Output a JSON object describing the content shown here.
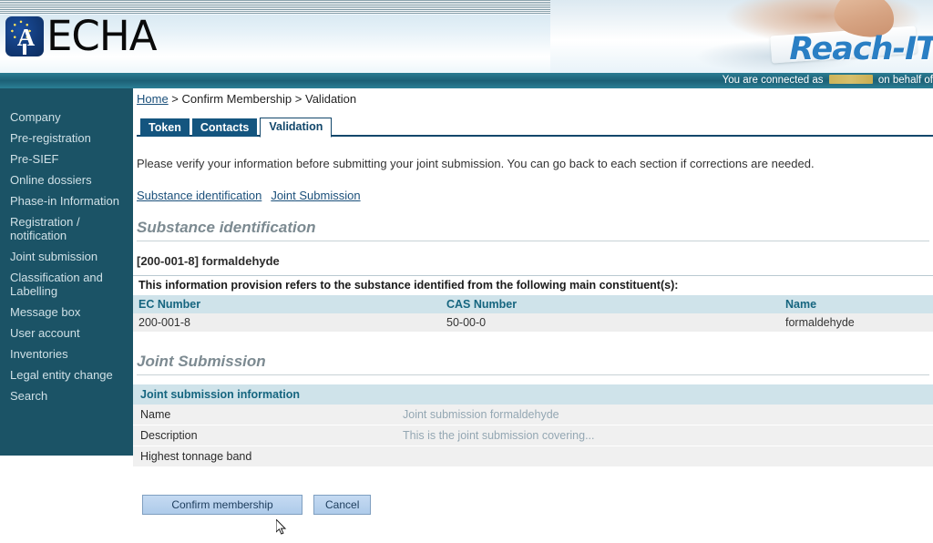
{
  "header": {
    "logo_text": "ECHA",
    "logo_mark_letter": "A",
    "brand": "Reach-IT",
    "connected_prefix": "You are connected as",
    "connected_user": "",
    "connected_suffix": "on behalf of"
  },
  "sidebar": {
    "items": [
      {
        "label": "Company"
      },
      {
        "label": "Pre-registration"
      },
      {
        "label": "Pre-SIEF"
      },
      {
        "label": "Online dossiers"
      },
      {
        "label": "Phase-in Information"
      },
      {
        "label": "Registration / notification"
      },
      {
        "label": "Joint submission"
      },
      {
        "label": "Classification and Labelling"
      },
      {
        "label": "Message box"
      },
      {
        "label": "User account"
      },
      {
        "label": "Inventories"
      },
      {
        "label": "Legal entity change"
      },
      {
        "label": "Search"
      }
    ]
  },
  "breadcrumb": {
    "home": "Home",
    "sep1": " > ",
    "level2": "Confirm Membership",
    "sep2": " > ",
    "level3": "Validation"
  },
  "tabs": [
    {
      "label": "Token",
      "active": false
    },
    {
      "label": "Contacts",
      "active": false
    },
    {
      "label": "Validation",
      "active": true
    }
  ],
  "main": {
    "intro": "Please verify your information before submitting your joint submission. You can go back to each section if corrections are needed.",
    "anchors": [
      {
        "label": "Substance identification"
      },
      {
        "label": "Joint Submission"
      }
    ],
    "substance_section": {
      "title": "Substance identification",
      "substance_label": "[200-001-8] formaldehyde",
      "table_caption": "This information provision refers to the substance identified from the following main constituent(s):",
      "columns": [
        "EC Number",
        "CAS Number",
        "Name"
      ],
      "rows": [
        [
          "200-001-8",
          "50-00-0",
          "formaldehyde"
        ]
      ]
    },
    "joint_section": {
      "title": "Joint Submission",
      "table_header": "Joint submission information",
      "rows": [
        {
          "key": "Name",
          "value": "Joint submission formaldehyde"
        },
        {
          "key": "Description",
          "value": "This is the joint submission covering..."
        },
        {
          "key": "Highest tonnage band",
          "value": ""
        }
      ]
    },
    "buttons": {
      "confirm": "Confirm membership",
      "cancel": "Cancel"
    }
  },
  "colors": {
    "sidebar_bg": "#1b5366",
    "tab_active_text": "#12476b",
    "tab_inactive_bg": "#14557f",
    "brand_blue": "#2a7fc4",
    "table_header_bg": "#cfe3ea",
    "table_header_text": "#15657f",
    "link": "#1a4f7a"
  }
}
